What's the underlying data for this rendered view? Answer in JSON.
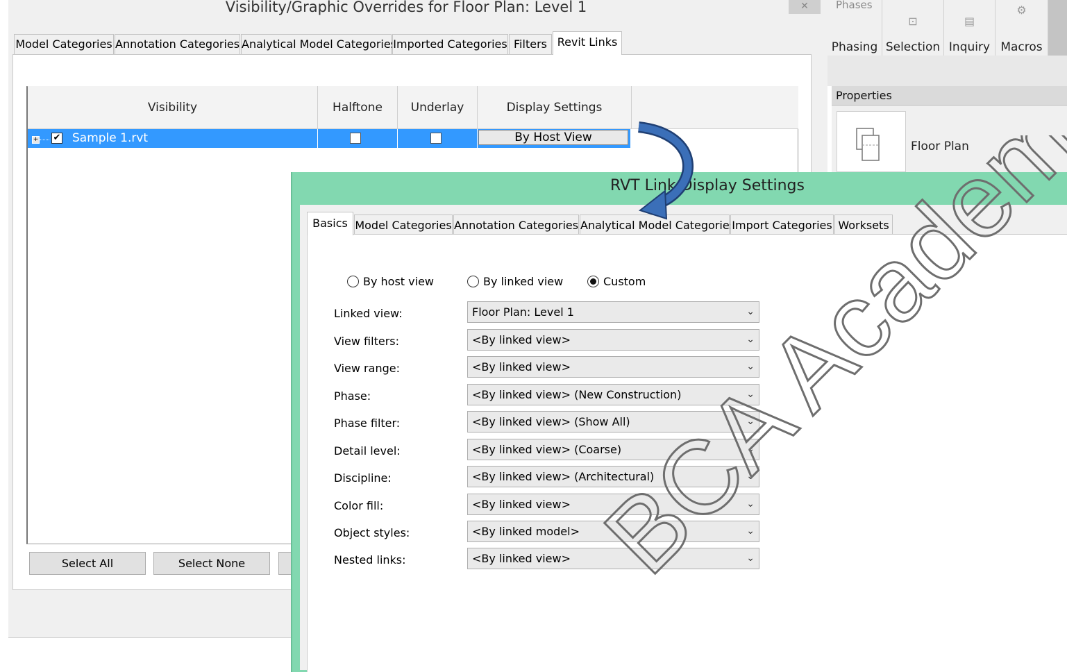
{
  "vg_dialog": {
    "title": "Visibility/Graphic Overrides for Floor Plan: Level 1",
    "close_label": "✕",
    "tabs": [
      {
        "label": "Model Categories"
      },
      {
        "label": "Annotation Categories"
      },
      {
        "label": "Analytical Model Categories"
      },
      {
        "label": "Imported Categories"
      },
      {
        "label": "Filters"
      },
      {
        "label": "Revit Links"
      }
    ],
    "active_tab": "Revit Links",
    "table": {
      "columns": [
        "Visibility",
        "Halftone",
        "Underlay",
        "Display Settings"
      ],
      "rows": [
        {
          "name": "Sample 1.rvt",
          "visible": true,
          "halftone": false,
          "underlay": false,
          "display_settings": "By Host View"
        }
      ]
    },
    "buttons": {
      "select_all": "Select All",
      "select_none": "Select None"
    }
  },
  "ribbon": {
    "panel_label": "Phases",
    "buttons": [
      {
        "label": "Phasing",
        "icon": "phasing-icon"
      },
      {
        "label": "Selection",
        "icon": "selection-icon"
      },
      {
        "label": "Inquiry",
        "icon": "inquiry-icon"
      },
      {
        "label": "Macros",
        "icon": "macros-icon"
      }
    ]
  },
  "properties": {
    "header": "Properties",
    "type_name": "Floor Plan",
    "icon": "floor-plan-icon"
  },
  "rvt_dialog": {
    "title": "RVT Link Display Settings",
    "tabs": [
      {
        "label": "Basics"
      },
      {
        "label": "Model Categories"
      },
      {
        "label": "Annotation Categories"
      },
      {
        "label": "Analytical Model Categories"
      },
      {
        "label": "Import Categories"
      },
      {
        "label": "Worksets"
      }
    ],
    "active_tab": "Basics",
    "radios": [
      {
        "label": "By host view",
        "selected": false
      },
      {
        "label": "By linked view",
        "selected": false
      },
      {
        "label": "Custom",
        "selected": true
      }
    ],
    "fields": [
      {
        "label": "Linked view:",
        "value": "Floor Plan: Level 1"
      },
      {
        "label": "View filters:",
        "value": "<By linked view>"
      },
      {
        "label": "View range:",
        "value": "<By linked view>"
      },
      {
        "label": "Phase:",
        "value": "<By linked view> (New Construction)"
      },
      {
        "label": "Phase filter:",
        "value": "<By linked view> (Show All)"
      },
      {
        "label": "Detail level:",
        "value": "<By linked view> (Coarse)"
      },
      {
        "label": "Discipline:",
        "value": "<By linked view> (Architectural)"
      },
      {
        "label": "Color fill:",
        "value": "<By linked view>"
      },
      {
        "label": "Object styles:",
        "value": "<By linked model>"
      },
      {
        "label": "Nested links:",
        "value": "<By linked view>"
      }
    ]
  },
  "watermark": {
    "text": "BCA Academy",
    "color": "#6e6e6e"
  },
  "colors": {
    "selection": "#3399ff",
    "dialog_frame": "#82d8b0",
    "arrow": "#2f5f9e"
  }
}
